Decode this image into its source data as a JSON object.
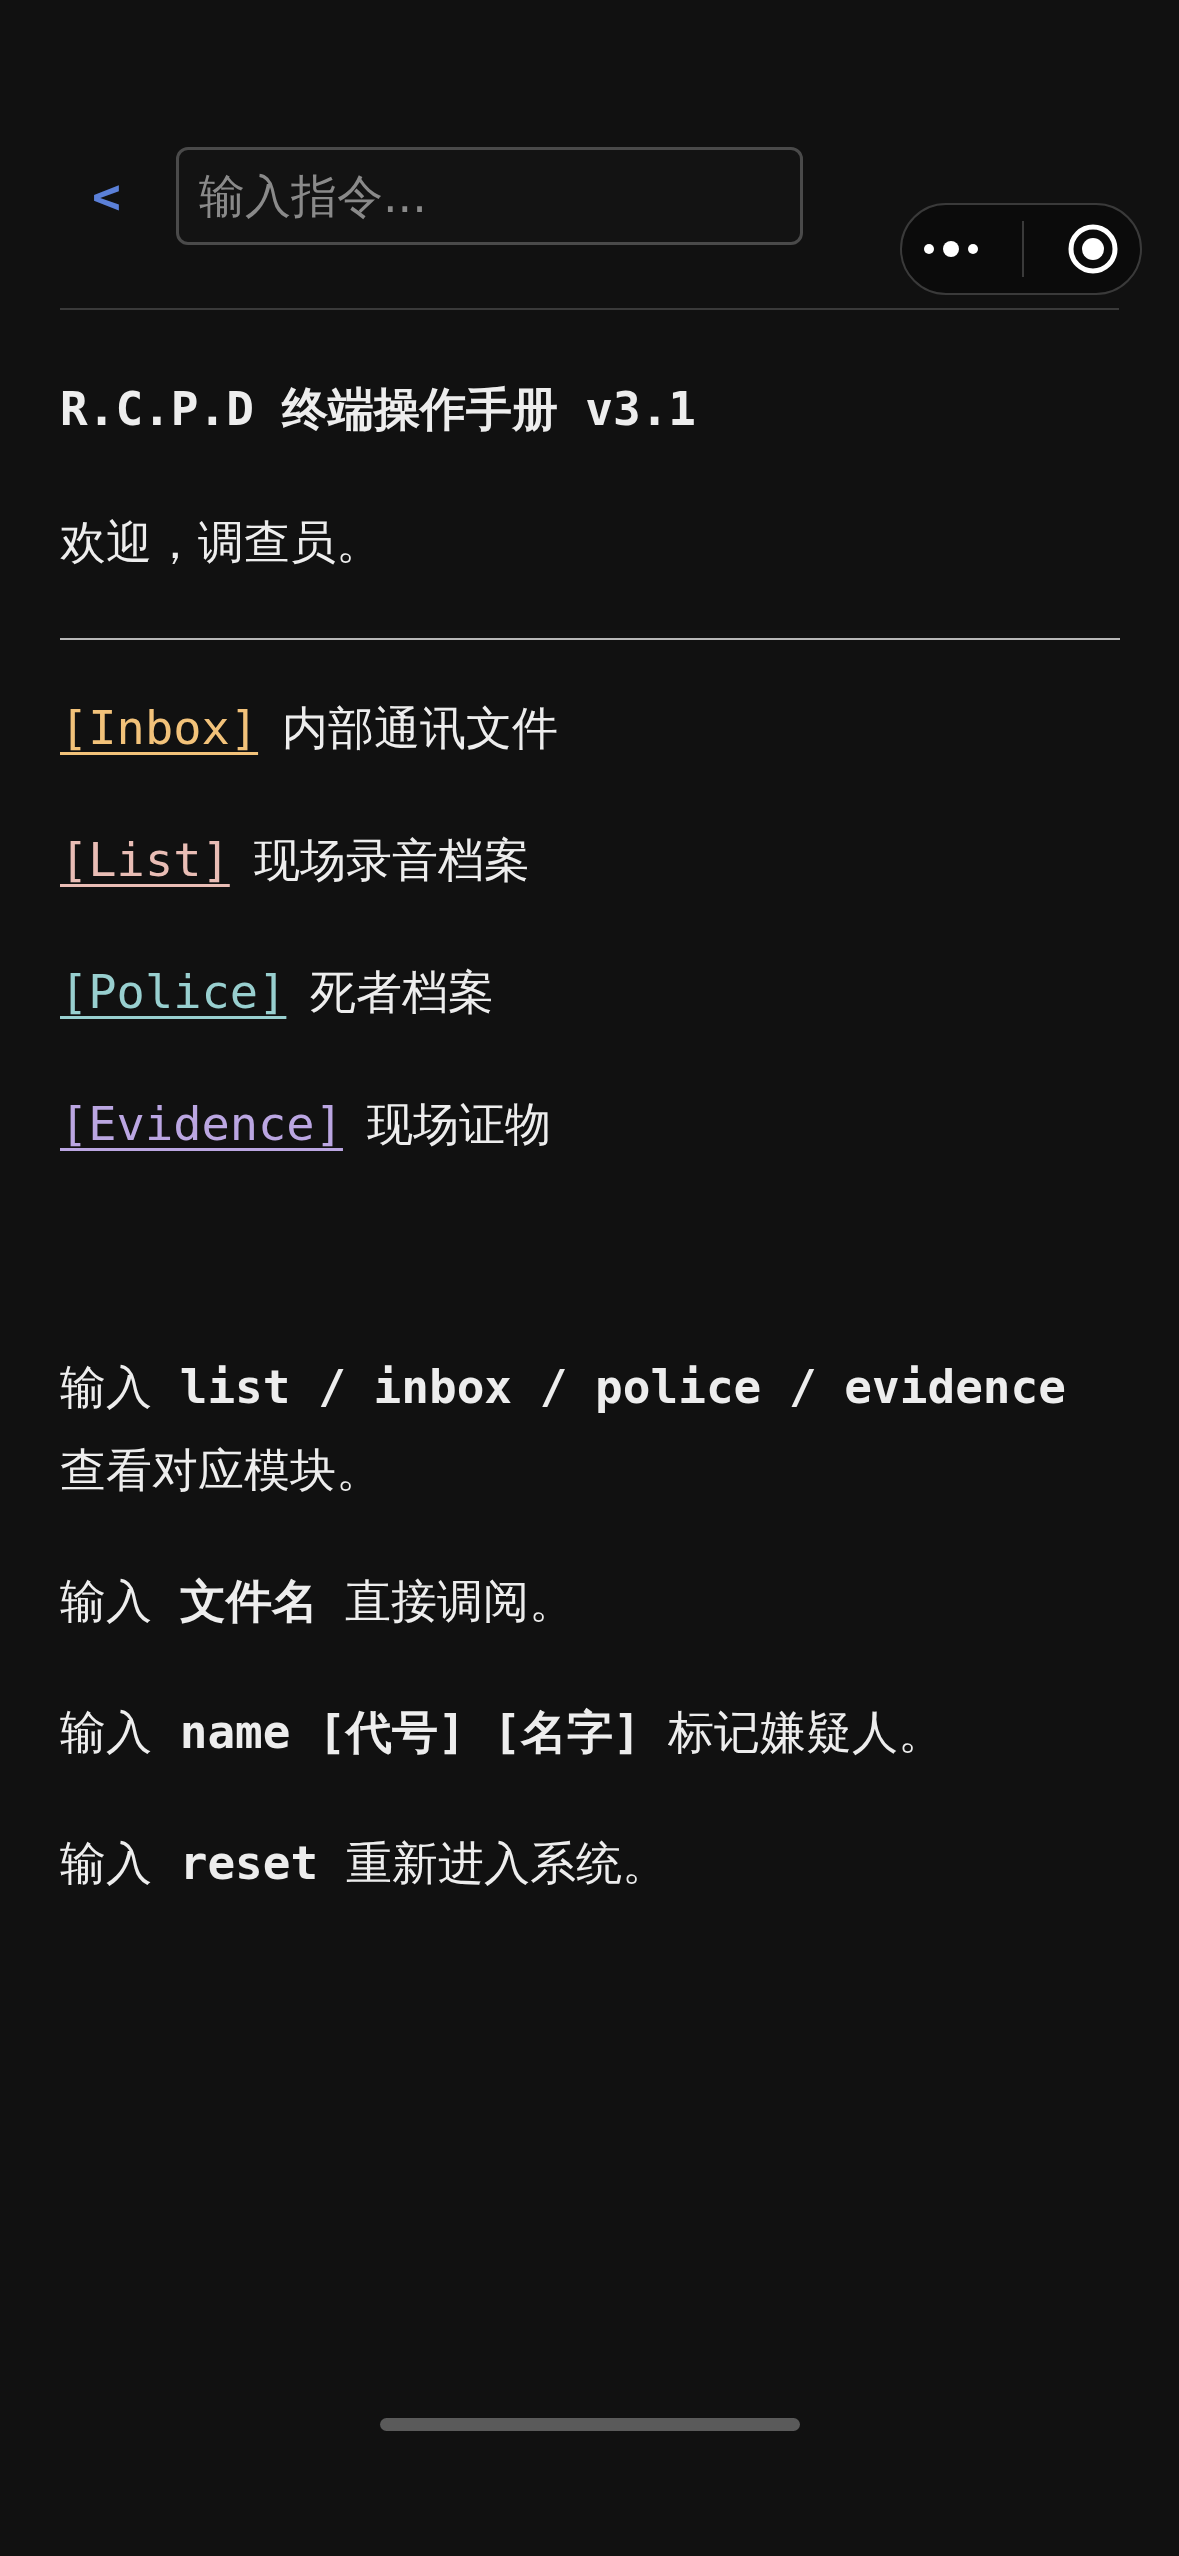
{
  "nav": {
    "back": "<",
    "command_field": {
      "placeholder": "输入指令..."
    }
  },
  "title": "R.C.P.D 终端操作手册 v3.1",
  "greeting": "欢迎，调查员。",
  "modules": [
    {
      "link": "[Inbox]",
      "label": "内部通讯文件",
      "color": "#f2c27a"
    },
    {
      "link": "[List]",
      "label": "现场录音档案",
      "color": "#e9bdb5"
    },
    {
      "link": "[Police]",
      "label": "死者档案",
      "color": "#98cfcf"
    },
    {
      "link": "[Evidence]",
      "label": "现场证物",
      "color": "#bba6e2"
    }
  ],
  "instructions": [
    "输入 **list / inbox / police / evidence** 查看对应模块。",
    "输入 **文件名** 直接调阅。",
    "输入 **name [代号] [名字]** 标记嫌疑人。",
    "输入 **reset** 重新进入系统。"
  ]
}
